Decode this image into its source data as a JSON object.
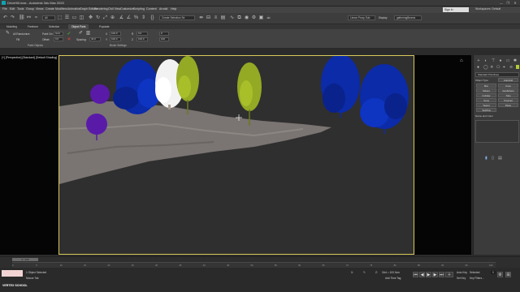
{
  "window": {
    "title": "DriveHill.max - Autodesk 3ds Max 2020",
    "minimize": "—",
    "maximize": "❐",
    "close": "✕"
  },
  "menu": {
    "items": [
      "File",
      "Edit",
      "Tools",
      "Group",
      "Views",
      "Create",
      "Modifiers",
      "Animation",
      "Graph Editors",
      "Rendering",
      "Civil View",
      "Customize",
      "Scripting",
      "Content",
      "Arnold",
      "Help"
    ],
    "sign_in": "Sign In",
    "workspaces_label": "Workspaces:",
    "workspace_value": "Default"
  },
  "toolbar": {
    "filter_value": "All",
    "selection_set": "Create Selection Se",
    "named_set": "Linear Proxy Sub",
    "display_mode": "Display",
    "object_name": "gatheringBeams"
  },
  "ribbon": {
    "tabs": [
      "Modeling",
      "Freeform",
      "Selection",
      "Object Paint",
      "Populate"
    ],
    "active_tab": "Object Paint",
    "paint_objects_group": "Paint Objects",
    "brush_settings_group": "Brush Settings",
    "pick_all_label": "All Randomize",
    "fill_label": "Fill",
    "paint_label": "Paint",
    "paint_on_label": "Paint On:",
    "paint_on_value": "Grid",
    "offset_label": "Offset:",
    "offset_value": "0.0",
    "spacing_label": "Spacing:",
    "spacing_value": "40.0",
    "scale_x": "100.0",
    "scale_y": "100.0",
    "scale_z": "100.0",
    "rotate_value": "0.0",
    "align_value": "Z",
    "count_value": "100"
  },
  "viewport": {
    "label": "[+] [Perspective] [Standard] [Default Shading]",
    "colors": {
      "blue_tree": "#0c2ba8",
      "white_tree": "#f2f2f2",
      "olive_tree": "#94a924",
      "purple_tree": "#5a1aa8",
      "terrain": "#7a7472",
      "active_border": "#d9c95a"
    }
  },
  "command_panel": {
    "object_type_heading": "Object Type",
    "buttons": [
      "AutoGrid",
      "Box",
      "Cone",
      "Sphere",
      "GeoSphere",
      "Cylinder",
      "Tube",
      "Torus",
      "Pyramid",
      "Teapot",
      "Plane",
      "TextPlus"
    ],
    "category": "Standard Primitives",
    "name_color_heading": "Name and Color"
  },
  "timeline": {
    "slider_text": "0 / 100",
    "ticks": [
      "0",
      "5",
      "10",
      "15",
      "20",
      "25",
      "30",
      "35",
      "40",
      "45",
      "50",
      "55",
      "60",
      "65",
      "70",
      "75",
      "80",
      "85",
      "90",
      "95",
      "100"
    ]
  },
  "status": {
    "selected": "1 Object Selected",
    "prompt": "Mouse Tab",
    "x_label": "X:",
    "y_label": "Y:",
    "z_label": "Z:",
    "grid_label": "Grid = 100.0cm",
    "add_time_tag": "Add Time Tag",
    "auto_key": "Auto Key",
    "set_key": "Set Key",
    "selected_mode": "Selected",
    "key_filters": "Key Filters...",
    "frame_value": "0",
    "watermark": "VERTEX SCHOOL"
  }
}
